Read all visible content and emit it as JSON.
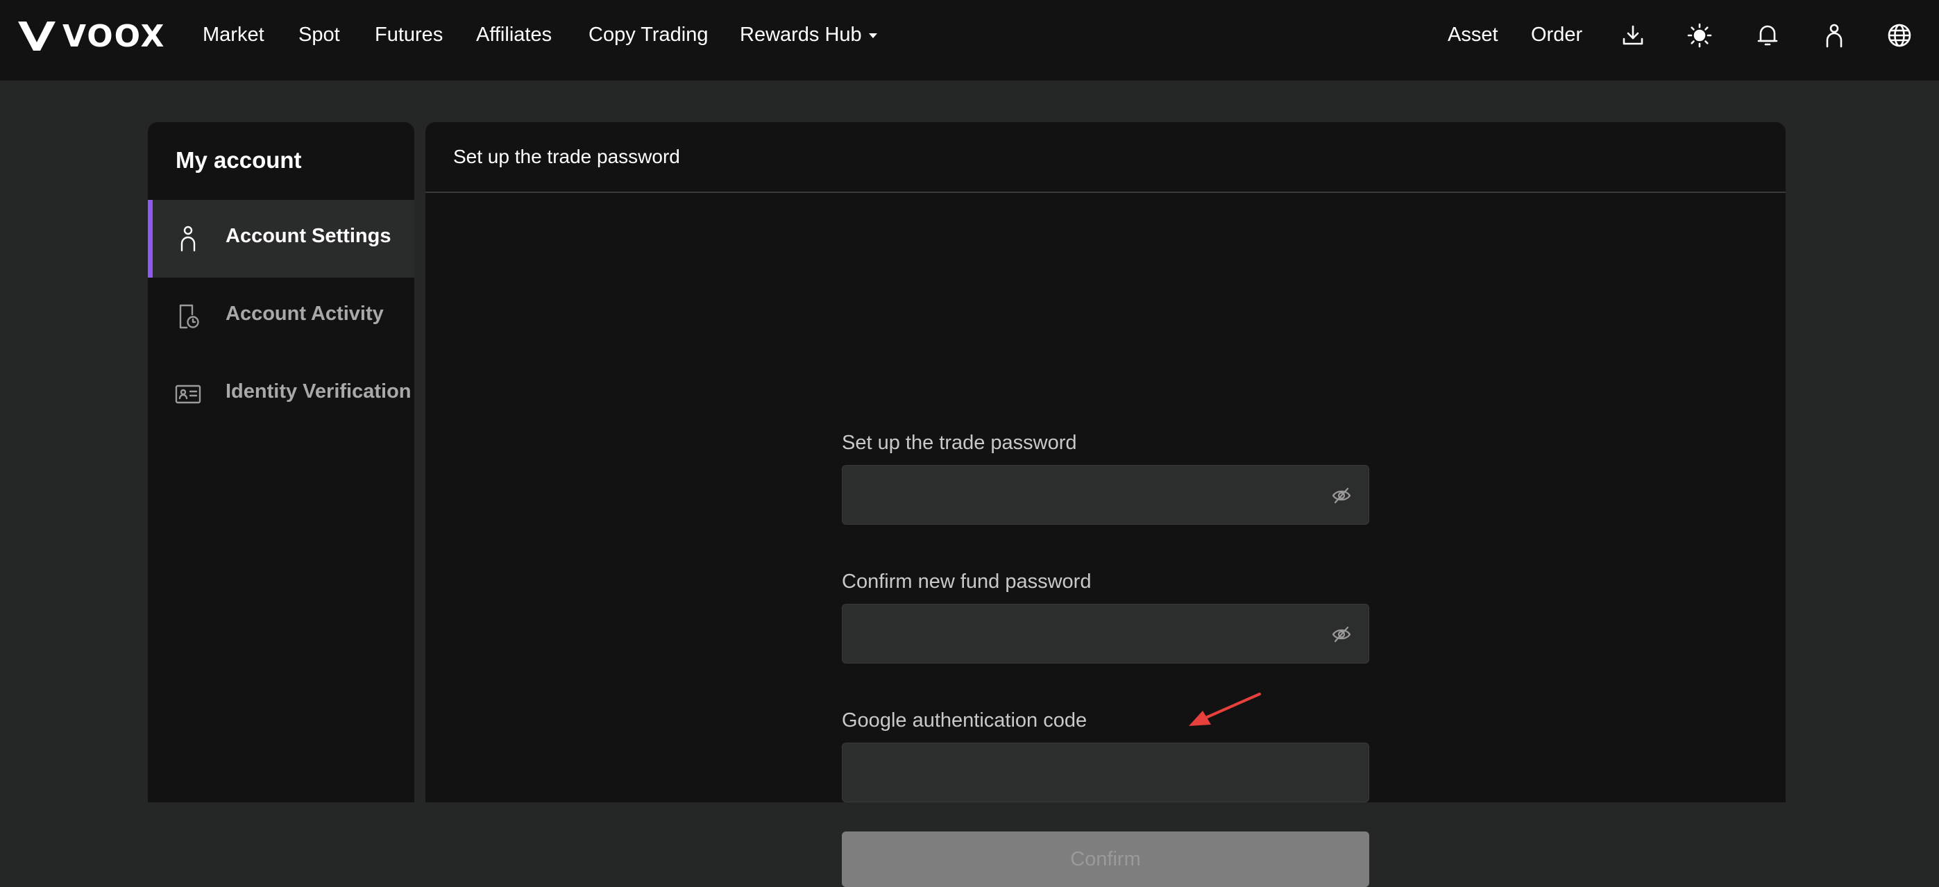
{
  "brand": {
    "name": "VOOX"
  },
  "nav": {
    "links": [
      "Market",
      "Spot",
      "Futures",
      "Affiliates",
      "Copy Trading",
      "Rewards Hub"
    ],
    "right_links": [
      "Asset",
      "Order"
    ],
    "icons": [
      "download-icon",
      "theme-sun-icon",
      "bell-icon",
      "user-icon",
      "globe-icon"
    ]
  },
  "sidebar": {
    "title": "My account",
    "items": [
      {
        "label": "Account Settings",
        "icon": "user-icon",
        "active": true
      },
      {
        "label": "Account Activity",
        "icon": "activity-log-icon",
        "active": false
      },
      {
        "label": "Identity Verification",
        "icon": "id-card-icon",
        "active": false
      }
    ]
  },
  "panel": {
    "title": "Set up the trade password"
  },
  "form": {
    "trade_password_label": "Set up the trade password",
    "trade_password_value": "",
    "confirm_password_label": "Confirm new fund password",
    "confirm_password_value": "",
    "google_code_label": "Google authentication code",
    "google_code_value": "",
    "confirm_button_label": "Confirm"
  },
  "colors": {
    "accent": "#8a5cf0",
    "background": "#252727",
    "panel": "#121212",
    "annotation_arrow": "#e8403c"
  }
}
